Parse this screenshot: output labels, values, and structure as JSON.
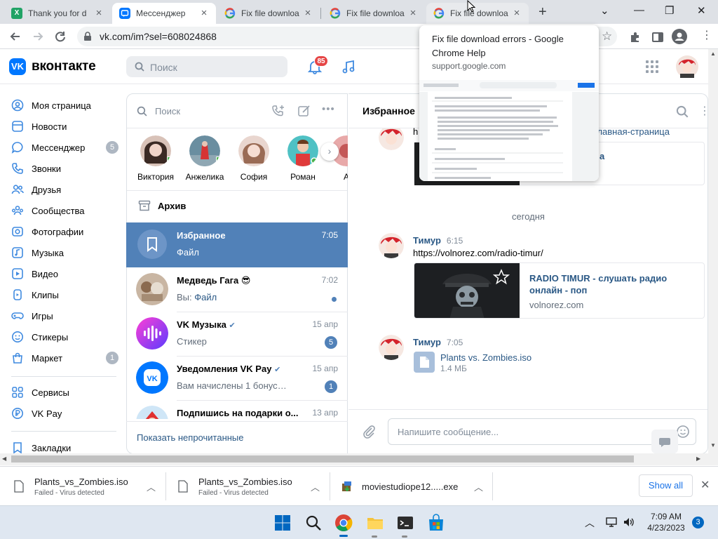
{
  "browser": {
    "tabs": [
      {
        "title": "Thank you for d",
        "favicon": "excel-icon"
      },
      {
        "title": "Мессенджер",
        "favicon": "vk-messenger-icon"
      },
      {
        "title": "Fix file downloa",
        "favicon": "google-icon"
      },
      {
        "title": "Fix file downloa",
        "favicon": "google-icon"
      },
      {
        "title": "Fix file downloa",
        "favicon": "google-icon"
      }
    ],
    "new_tab_label": "+",
    "url": "vk.com/im?sel=608024868",
    "hovercard": {
      "title": "Fix file download errors - Google Chrome Help",
      "domain": "support.google.com"
    }
  },
  "vk": {
    "logo_text": "VK",
    "brand": "вконтакте",
    "search_placeholder": "Поиск",
    "notifications_count": "85",
    "menu": [
      {
        "label": "Моя страница",
        "icon": "user-circle-icon"
      },
      {
        "label": "Новости",
        "icon": "news-icon"
      },
      {
        "label": "Мессенджер",
        "icon": "message-icon",
        "badge": "5"
      },
      {
        "label": "Звонки",
        "icon": "phone-icon"
      },
      {
        "label": "Друзья",
        "icon": "friends-icon"
      },
      {
        "label": "Сообщества",
        "icon": "communities-icon"
      },
      {
        "label": "Фотографии",
        "icon": "photo-icon"
      },
      {
        "label": "Музыка",
        "icon": "music-icon"
      },
      {
        "label": "Видео",
        "icon": "video-icon"
      },
      {
        "label": "Клипы",
        "icon": "clips-icon"
      },
      {
        "label": "Игры",
        "icon": "games-icon"
      },
      {
        "label": "Стикеры",
        "icon": "sticker-icon"
      },
      {
        "label": "Маркет",
        "icon": "market-icon",
        "badge": "1"
      },
      {
        "label": "Сервисы",
        "icon": "services-icon"
      },
      {
        "label": "VK Pay",
        "icon": "vkpay-icon"
      },
      {
        "label": "Закладки",
        "icon": "bookmark-icon"
      }
    ],
    "chatlist": {
      "search_placeholder": "Поиск",
      "stories": [
        "Виктория",
        "Анжелика",
        "София",
        "Роман",
        "А"
      ],
      "archive_label": "Архив",
      "chats": [
        {
          "name": "Избранное",
          "time": "7:05",
          "preview": "Файл",
          "active": true
        },
        {
          "name": "Медведь Гага 😎",
          "time": "7:02",
          "preview_prefix": "Вы:",
          "preview": "Файл"
        },
        {
          "name": "VK Музыка",
          "time": "15 апр",
          "preview": "Стикер",
          "badge": "5"
        },
        {
          "name": "Уведомления VK Pay",
          "time": "15 апр",
          "preview": "Вам начислены 1 бонусо...",
          "badge": "1"
        },
        {
          "name": "Подпишись на подарки о...",
          "time": "13 апр",
          "preview": ""
        }
      ],
      "show_unread_label": "Показать непрочитанные"
    },
    "conversation": {
      "title": "Избранное",
      "prev_link_fragment": "главная-страница",
      "date_divider": "сегодня",
      "messages": [
        {
          "author": "Тимур",
          "time": "6:15",
          "text": "https://volnorez.com/radio-timur/",
          "link_card": {
            "title": "RADIO TIMUR - слушать радио онлайн - поп",
            "domain": "volnorez.com"
          }
        },
        {
          "author": "Тимур",
          "time": "7:05",
          "file": {
            "name": "Plants vs. Zombies.iso",
            "size": "1.4 МБ"
          }
        }
      ],
      "input_placeholder": "Напишите сообщение..."
    }
  },
  "downloads": {
    "items": [
      {
        "name": "Plants_vs_Zombies.iso",
        "status": "Failed - Virus detected"
      },
      {
        "name": "Plants_vs_Zombies.iso",
        "status": "Failed - Virus detected"
      },
      {
        "name": "moviestudiope12.....exe",
        "status": ""
      }
    ],
    "show_all_label": "Show all"
  },
  "taskbar": {
    "time": "7:09 AM",
    "date": "4/23/2023",
    "notification_count": "3"
  },
  "colors": {
    "vk_blue": "#0077ff",
    "active_chat": "#5181b8",
    "link": "#2a5885"
  }
}
